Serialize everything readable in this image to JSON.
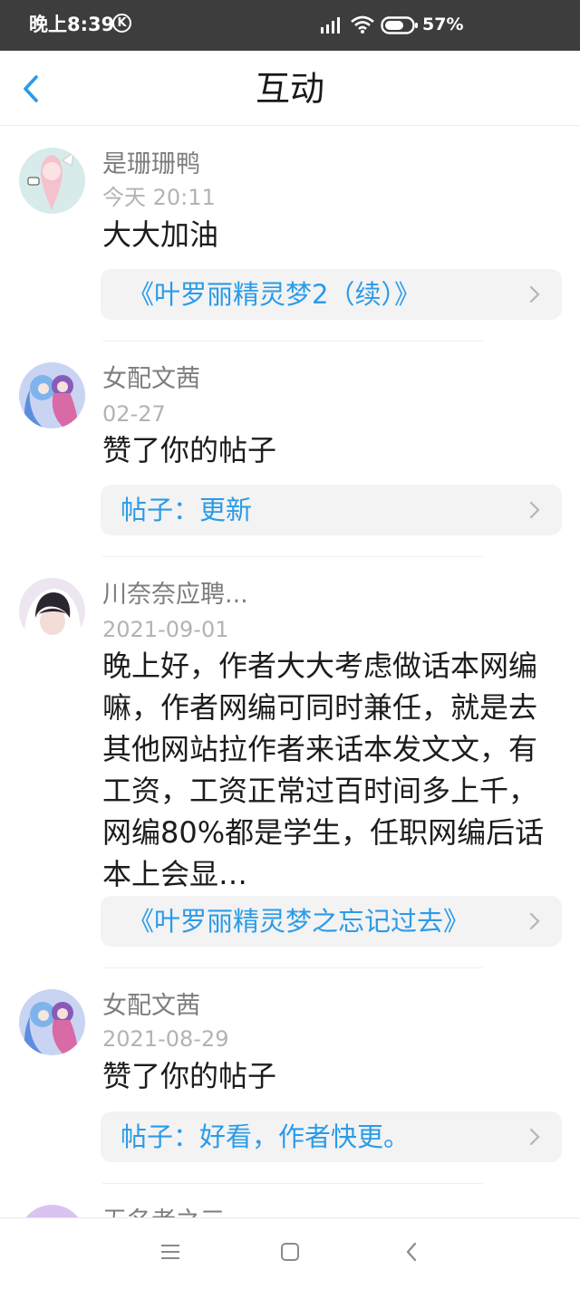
{
  "status": {
    "time": "晚上8:39",
    "k_icon_label": "K",
    "battery": "57%"
  },
  "header": {
    "title": "互动"
  },
  "notifications": [
    {
      "user": "是珊珊鸭",
      "time": "今天 20:11",
      "content": "大大加油",
      "link": "《叶罗丽精灵梦2（续）》",
      "avatar_icon": "user-avatar"
    },
    {
      "user": "女配文茜",
      "time": "02-27",
      "content": "赞了你的帖子",
      "link": "帖子：更新",
      "avatar_icon": "user-avatar"
    },
    {
      "user": "川奈奈应聘...",
      "time": "2021-09-01",
      "content": "晚上好，作者大大考虑做话本网编嘛，作者网编可同时兼任，就是去其他网站拉作者来话本发文文，有工资，工资正常过百时间多上千，网编80%都是学生，任职网编后话本上会显…",
      "link": "《叶罗丽精灵梦之忘记过去》",
      "avatar_icon": "user-avatar"
    },
    {
      "user": "女配文茜",
      "time": "2021-08-29",
      "content": "赞了你的帖子",
      "link": "帖子：好看，作者快更。",
      "avatar_icon": "user-avatar"
    },
    {
      "user": "无名者之三",
      "avatar_icon": "user-avatar"
    }
  ],
  "nav": {
    "menu_icon": "menu-icon",
    "home_icon": "home-square-icon",
    "back_icon": "back-triangle-icon"
  },
  "colors": {
    "accent": "#2a9be8",
    "status_bar": "#3d3d3d",
    "card_bg": "#f3f3f3"
  }
}
